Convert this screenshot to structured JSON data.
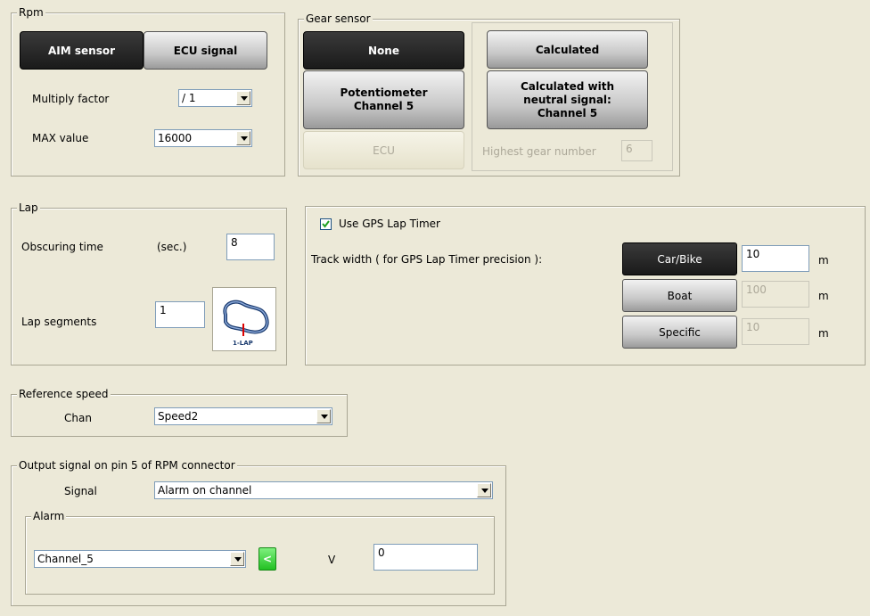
{
  "rpm": {
    "legend": "Rpm",
    "aim_sensor": "AIM sensor",
    "ecu_signal": "ECU signal",
    "multiply_label": "Multiply factor",
    "multiply_value": "/ 1",
    "max_label": "MAX value",
    "max_value": "16000"
  },
  "gear": {
    "legend": "Gear sensor",
    "none": "None",
    "calculated": "Calculated",
    "potentiometer": "Potentiometer\nChannel 5",
    "calc_neutral": "Calculated with\nneutral signal:\nChannel 5",
    "ecu": "ECU",
    "highest_label": "Highest gear number",
    "highest_value": "6"
  },
  "lap": {
    "legend": "Lap",
    "obscuring_label": "Obscuring time",
    "obscuring_unit": "(sec.)",
    "obscuring_value": "8",
    "segments_label": "Lap segments",
    "segments_value": "1",
    "track_caption": "1-LAP"
  },
  "gps": {
    "use_label": "Use GPS Lap Timer",
    "checked": true,
    "track_width_label": "Track width ( for GPS Lap Timer precision ):",
    "options": [
      {
        "label": "Car/Bike",
        "value": "10",
        "unit": "m"
      },
      {
        "label": "Boat",
        "value": "100",
        "unit": "m"
      },
      {
        "label": "Specific",
        "value": "10",
        "unit": "m"
      }
    ]
  },
  "refspeed": {
    "legend": "Reference speed",
    "chan_label": "Chan",
    "chan_value": "Speed2"
  },
  "output": {
    "legend": "Output signal on pin 5 of RPM connector",
    "signal_label": "Signal",
    "signal_value": "Alarm on channel",
    "alarm": {
      "legend": "Alarm",
      "channel": "Channel_5",
      "compare": "<",
      "unit": "V",
      "value": "0"
    }
  }
}
